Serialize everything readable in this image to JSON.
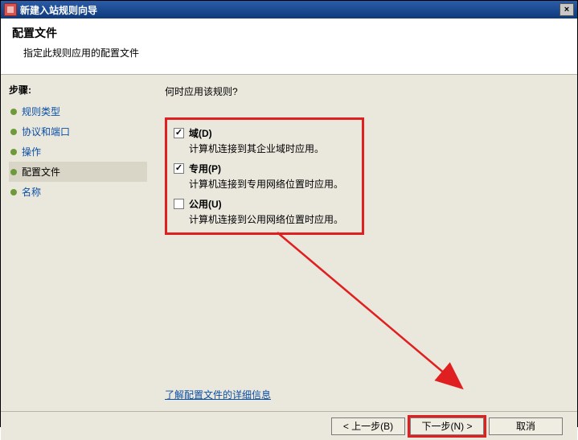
{
  "titlebar": {
    "title": "新建入站规则向导",
    "close": "×"
  },
  "header": {
    "title": "配置文件",
    "subtitle": "指定此规则应用的配置文件"
  },
  "sidebar": {
    "title": "步骤:",
    "items": [
      {
        "label": "规则类型",
        "current": false
      },
      {
        "label": "协议和端口",
        "current": false
      },
      {
        "label": "操作",
        "current": false
      },
      {
        "label": "配置文件",
        "current": true
      },
      {
        "label": "名称",
        "current": false
      }
    ]
  },
  "main": {
    "question": "何时应用该规则?",
    "profiles": [
      {
        "label": "域(D)",
        "desc": "计算机连接到其企业域时应用。",
        "checked": true
      },
      {
        "label": "专用(P)",
        "desc": "计算机连接到专用网络位置时应用。",
        "checked": true
      },
      {
        "label": "公用(U)",
        "desc": "计算机连接到公用网络位置时应用。",
        "checked": false
      }
    ],
    "learn_link": "了解配置文件的详细信息"
  },
  "footer": {
    "back": "< 上一步(B)",
    "next": "下一步(N) >",
    "cancel": "取消"
  }
}
